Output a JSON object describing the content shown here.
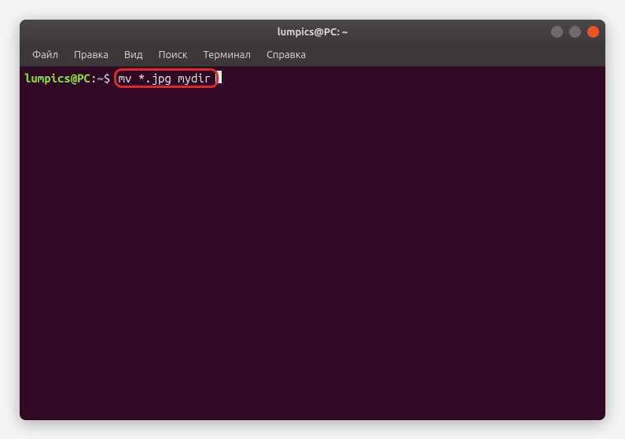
{
  "window": {
    "title": "lumpics@PC: ~"
  },
  "menubar": {
    "items": [
      {
        "label": "Файл"
      },
      {
        "label": "Правка"
      },
      {
        "label": "Вид"
      },
      {
        "label": "Поиск"
      },
      {
        "label": "Терминал"
      },
      {
        "label": "Справка"
      }
    ]
  },
  "terminal": {
    "prompt_user": "lumpics@PC",
    "prompt_colon": ":",
    "prompt_path": "~",
    "prompt_dollar": "$",
    "command": "mv *.jpg mydir"
  },
  "colors": {
    "titlebar_bg": "#3c383b",
    "terminal_bg": "#300a24",
    "prompt_user_color": "#8ae234",
    "prompt_path_color": "#729fcf",
    "text_color": "#eeeeec",
    "highlight_border": "#d92b2b",
    "close_btn": "#e95420"
  }
}
